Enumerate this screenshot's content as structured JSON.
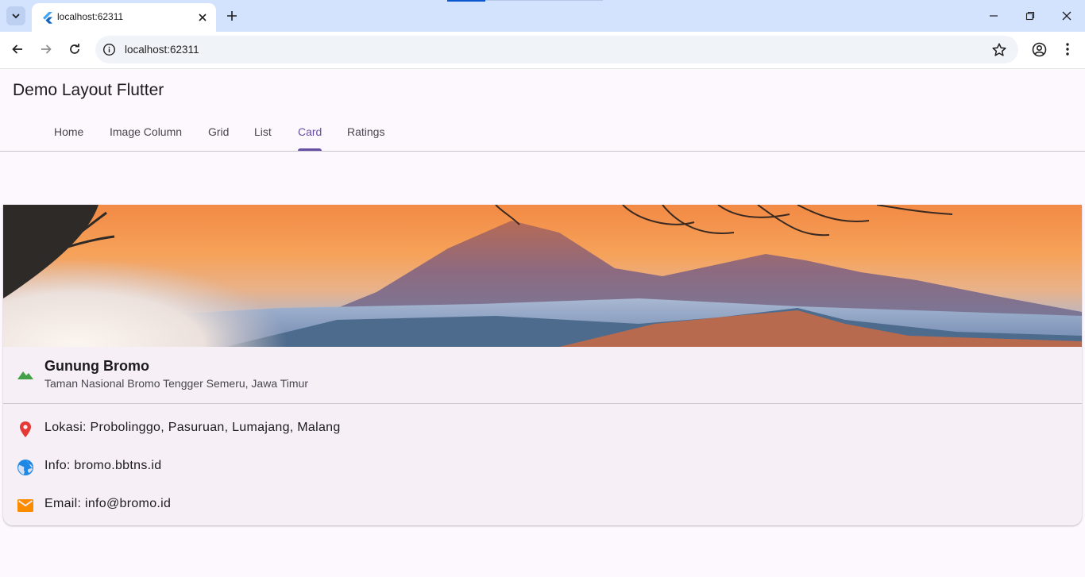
{
  "browser": {
    "tab_title": "localhost:62311",
    "url": "localhost:62311"
  },
  "app": {
    "title": "Demo Layout Flutter",
    "tabs": [
      {
        "label": "Home"
      },
      {
        "label": "Image Column"
      },
      {
        "label": "Grid"
      },
      {
        "label": "List"
      },
      {
        "label": "Card"
      },
      {
        "label": "Ratings"
      }
    ],
    "active_tab": "Card"
  },
  "card": {
    "title": "Gunung Bromo",
    "subtitle": "Taman Nasional Bromo Tengger Semeru, Jawa Timur",
    "rows": [
      {
        "icon": "location-pin-icon",
        "text": "Lokasi: Probolinggo, Pasuruan, Lumajang, Malang",
        "color": "#e53935"
      },
      {
        "icon": "globe-icon",
        "text": "Info: bromo.bbtns.id",
        "color": "#1e88e5"
      },
      {
        "icon": "email-icon",
        "text": "Email: info@bromo.id",
        "color": "#fb8c00"
      }
    ],
    "header_icon": "mountain-icon",
    "header_icon_color": "#43a047"
  },
  "colors": {
    "accent": "#6750a4",
    "browser_frame": "#d3e3fd"
  }
}
